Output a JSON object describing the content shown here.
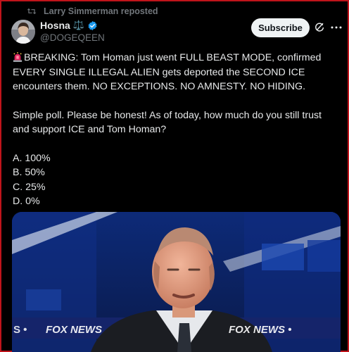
{
  "repost": {
    "text": "Larry Simmerman reposted",
    "icon": "repost-icon"
  },
  "author": {
    "name": "Hosna",
    "emoji": "⚖️",
    "handle": "@DOGEQEEN",
    "verified": true
  },
  "actions": {
    "subscribe_label": "Subscribe",
    "grok_icon": "grok-icon",
    "more_icon": "more-icon"
  },
  "post": {
    "headline": "BREAKING: Tom Homan just went FULL BEAST MODE, confirmed EVERY SINGLE ILLEGAL ALIEN gets deported the SECOND ICE encounters them. NO EXCEPTIONS. NO AMNESTY. NO HIDING.",
    "question": "Simple poll. Please be honest! As of today, how much do you still trust and support ICE and Tom Homan?",
    "options": [
      "A. 100%",
      "B. 50%",
      "C. 25%",
      "D. 0%"
    ]
  },
  "media": {
    "ticker_left": "S • ",
    "ticker_brand": "FOX NEWS",
    "ticker_right": "FOX NEWS •"
  },
  "colors": {
    "accent_red": "#c0141b",
    "verified_blue": "#1d9bf0",
    "muted": "#71767b"
  }
}
